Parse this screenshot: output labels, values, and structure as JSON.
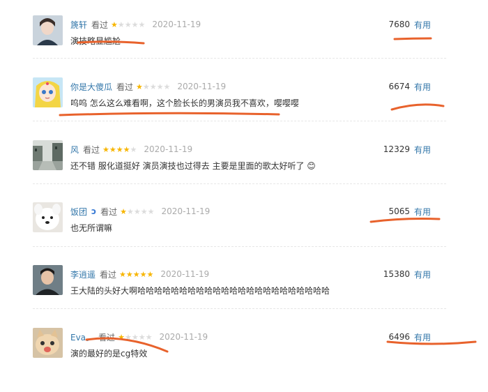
{
  "reviews": [
    {
      "username": "篪轩",
      "badge": "",
      "status": "看过",
      "rating": 1,
      "date": "2020-11-19",
      "content": "演技略显尴尬",
      "votes": "7680",
      "useful": "有用",
      "avatar": "woman-portrait"
    },
    {
      "username": "你是大傻瓜",
      "badge": "",
      "status": "看过",
      "rating": 1,
      "date": "2020-11-19",
      "content": "呜呜 怎么这么难看啊，这个脸长长的男演员我不喜欢，嘤嘤嘤",
      "votes": "6674",
      "useful": "有用",
      "avatar": "anime-girl"
    },
    {
      "username": "风",
      "badge": "",
      "status": "看过",
      "rating": 4,
      "date": "2020-11-19",
      "content": "还不错 服化道挺好 演员演技也过得去 主要是里面的歌太好听了 😊",
      "votes": "12329",
      "useful": "有用",
      "avatar": "street-scene"
    },
    {
      "username": "饭团",
      "badge": "ↄ",
      "status": "看过",
      "rating": 1,
      "date": "2020-11-19",
      "content": "也无所谓嘛",
      "votes": "5065",
      "useful": "有用",
      "avatar": "white-dog"
    },
    {
      "username": "李逍遥",
      "badge": "",
      "status": "看过",
      "rating": 5,
      "date": "2020-11-19",
      "content": "王大陆的头好大啊哈哈哈哈哈哈哈哈哈哈哈哈哈哈哈哈哈哈哈哈哈哈哈",
      "votes": "15380",
      "useful": "有用",
      "avatar": "man-portrait"
    },
    {
      "username": "Eva。",
      "badge": "",
      "status": "看过",
      "rating": 1,
      "date": "2020-11-19",
      "content": "演的最好的是cg特效",
      "votes": "6496",
      "useful": "有用",
      "avatar": "cat-face"
    }
  ],
  "colors": {
    "annotation": "#e8622c",
    "star": "#f7b500",
    "link": "#3377aa"
  }
}
